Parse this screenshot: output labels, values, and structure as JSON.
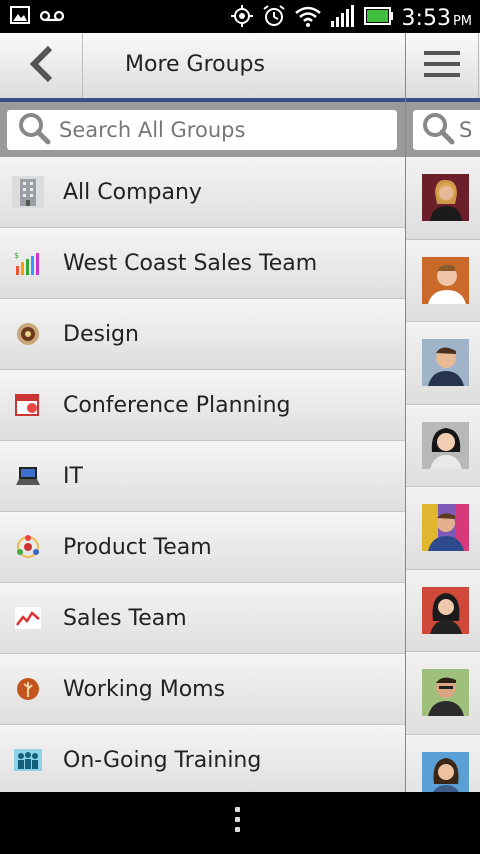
{
  "status": {
    "time": "3:53",
    "ampm": "PM",
    "icons": [
      "gallery-icon",
      "voicemail-icon",
      "gps-icon",
      "alarm-icon",
      "wifi-icon",
      "signal-icon",
      "battery-icon"
    ]
  },
  "header": {
    "title": "More Groups",
    "back_icon": "chevron-left-icon"
  },
  "search": {
    "placeholder": "Search All Groups",
    "value": ""
  },
  "side": {
    "menu_icon": "hamburger-icon",
    "search_partial": "S"
  },
  "groups": [
    {
      "label": "All Company",
      "icon": "building-icon"
    },
    {
      "label": "West Coast Sales Team",
      "icon": "bar-chart-icon"
    },
    {
      "label": "Design",
      "icon": "flower-icon"
    },
    {
      "label": "Conference Planning",
      "icon": "calendar-icon"
    },
    {
      "label": "IT",
      "icon": "laptop-icon"
    },
    {
      "label": "Product Team",
      "icon": "team-circle-icon"
    },
    {
      "label": "Sales Team",
      "icon": "line-chart-icon"
    },
    {
      "label": "Working Moms",
      "icon": "tree-icon"
    },
    {
      "label": "On-Going Training",
      "icon": "people-icon"
    }
  ],
  "colors": {
    "accent": "#3a4f86",
    "background": "#e9e9e9"
  }
}
